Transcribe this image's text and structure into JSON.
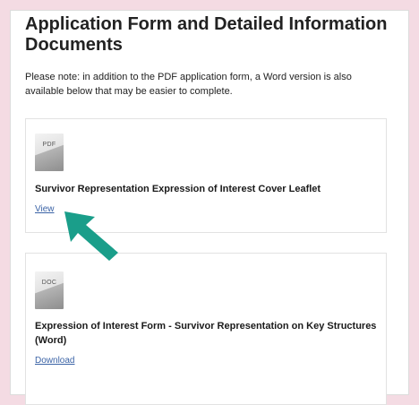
{
  "section": {
    "title": "Application Form and Detailed Information Documents",
    "note": "Please note: in addition to the PDF application form, a Word version is also available below that may be easier to complete."
  },
  "documents": [
    {
      "file_type": "PDF",
      "title": "Survivor Representation Expression of Interest Cover Leaflet",
      "action_label": "View"
    },
    {
      "file_type": "DOC",
      "title": "Expression of Interest Form - Survivor Representation on Key Structures (Word)",
      "action_label": "Download"
    }
  ],
  "overlay": {
    "arrow_icon": "pointer-arrow-icon",
    "arrow_color": "#1a9e8a"
  },
  "colors": {
    "background": "#f4dbe3",
    "link": "#3b63a6"
  }
}
